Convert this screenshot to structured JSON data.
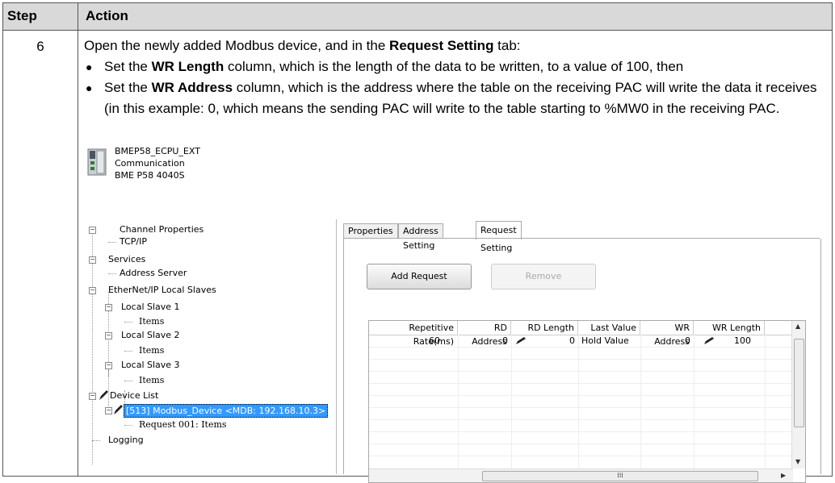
{
  "table": {
    "header_step": "Step",
    "header_action": "Action",
    "step_number": "6"
  },
  "action": {
    "intro_prefix": "Open the newly added Modbus device, and in the ",
    "intro_bold": "Request Setting",
    "intro_suffix": " tab:",
    "bullet1_prefix": "Set the ",
    "bullet1_bold": "WR Length",
    "bullet1_suffix": " column, which is the length of the data to be written, to a value of 100, then",
    "bullet2_prefix": "Set the ",
    "bullet2_bold": "WR Address",
    "bullet2_suffix": " column, which is the address where the table on the receiving PAC will write the data it receives (in this example: 0, which means the sending PAC will write to the table starting to %MW0 in the receiving PAC."
  },
  "device": {
    "name": "BMEP58_ECPU_EXT",
    "category": "Communication",
    "model": "BME P58 4040S"
  },
  "tree": {
    "channel_properties": "Channel Properties",
    "tcpip": "TCP/IP",
    "services": "Services",
    "address_server": "Address Server",
    "ethernet_slaves": "EtherNet/IP Local Slaves",
    "local_slave_1": "Local Slave 1",
    "items_1": "Items",
    "local_slave_2": "Local Slave 2",
    "items_2": "Items",
    "local_slave_3": "Local Slave 3",
    "items_3": "Items",
    "device_list": "Device List",
    "modbus_device": "[513] Modbus_Device <MDB: 192.168.10.3>",
    "request_001": "Request 001: Items",
    "logging": "Logging"
  },
  "tabs": {
    "properties": "Properties",
    "address_setting": "Address Setting",
    "request_setting": "Request Setting"
  },
  "buttons": {
    "add_request": "Add Request",
    "remove": "Remove"
  },
  "grid": {
    "columns": {
      "rep_rate": "Repetitive Rate(ms)",
      "rd_address": "RD Address",
      "rd_length": "RD Length",
      "last_value": "Last Value",
      "wr_address": "WR Address",
      "wr_length": "WR Length"
    },
    "row1": {
      "rep_rate": "60",
      "rd_address": "0",
      "rd_length": "0",
      "last_value": "Hold Value",
      "wr_address": "0",
      "wr_length": "100"
    }
  }
}
